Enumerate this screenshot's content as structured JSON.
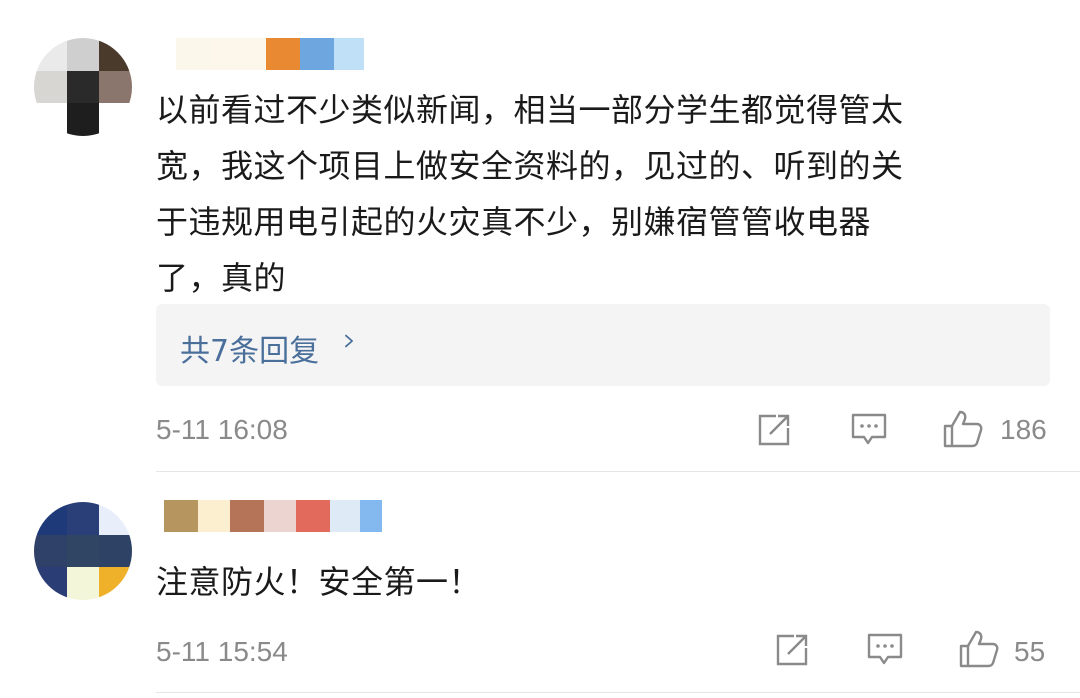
{
  "comments": [
    {
      "avatar_colors": [
        "#eaeaea",
        "#cfcfcf",
        "#4a3a2c",
        "#d7d6d2",
        "#2a2a2a",
        "#8a766d",
        "#ffffff",
        "#1e1e1e",
        "#ffffff"
      ],
      "name_colors": [
        "#ffffff",
        "#fbf7ea",
        "#fdf6ea",
        "#fdf6ea",
        "#e98a32",
        "#6ea7e0",
        "#bfe0f6"
      ],
      "lines": [
        "以前看过不少类似新闻，相当一部分学生都觉得管太",
        "宽，我这个项目上做安全资料的，见过的、听到的关",
        "于违规用电引起的火灾真不少，别嫌宿管管收电器",
        "了，真的"
      ],
      "replies_label": "共7条回复",
      "timestamp": "5-11 16:08",
      "likes": "186"
    },
    {
      "avatar_colors": [
        "#1f3a78",
        "#2a3f77",
        "#e9eefb",
        "#2f4169",
        "#304464",
        "#2e4266",
        "#2a3d74",
        "#f3f6d8",
        "#f0b12a"
      ],
      "name_colors": [
        "#ffffff",
        "#b6955f",
        "#fcefcf",
        "#b57458",
        "#ecd4d0",
        "#e26a5c",
        "#dfeaf7",
        "#84b9ef"
      ],
      "lines": [
        "注意防火！安全第一！"
      ],
      "timestamp": "5-11 15:54",
      "likes": "55"
    }
  ],
  "icons": {
    "share": "share-icon",
    "comment": "comment-icon",
    "like": "thumbs-up-icon",
    "chevron": "chevron-right-icon"
  }
}
